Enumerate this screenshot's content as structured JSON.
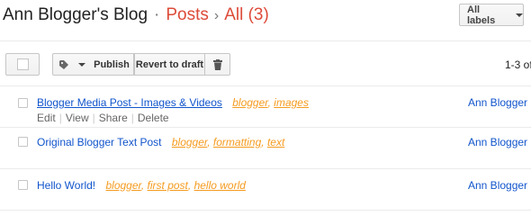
{
  "header": {
    "blog_title": "Ann Blogger's Blog",
    "separator": "·",
    "section": "Posts",
    "arrow": "›",
    "filter": "All (3)",
    "labels_button": "All labels"
  },
  "toolbar": {
    "publish": "Publish",
    "revert": "Revert to draft",
    "pager": "1-3 of"
  },
  "posts": [
    {
      "title": "Blogger Media Post - Images & Videos",
      "labels": [
        "blogger",
        "images"
      ],
      "author": "Ann Blogger",
      "actions": [
        "Edit",
        "View",
        "Share",
        "Delete"
      ]
    },
    {
      "title": "Original Blogger Text Post",
      "labels": [
        "blogger",
        "formatting",
        "text"
      ],
      "author": "Ann Blogger"
    },
    {
      "title": "Hello World!",
      "labels": [
        "blogger",
        "first post",
        "hello world"
      ],
      "author": "Ann Blogger"
    }
  ],
  "colors": {
    "accent": "#dd4b39",
    "link": "#1155cc",
    "label": "#f59b1f"
  },
  "icons": [
    "tag-icon",
    "trash-icon",
    "chevron-down-icon"
  ]
}
